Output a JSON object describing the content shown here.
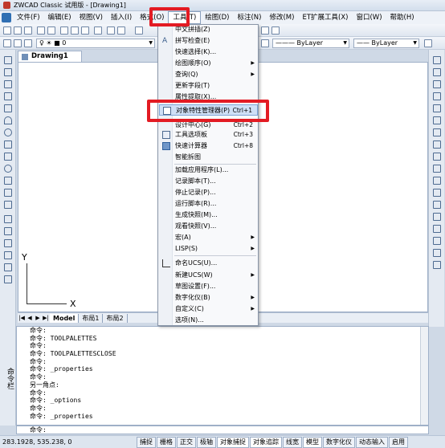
{
  "window": {
    "title": "ZWCAD Classic 试用版 - [Drawing1]"
  },
  "menubar": {
    "items": [
      "文件(F)",
      "编辑(E)",
      "视图(V)",
      "插入(I)",
      "格式(O)",
      "工具(T)",
      "绘图(D)",
      "标注(N)",
      "修改(M)",
      "ET扩展工具(X)",
      "窗口(W)",
      "帮助(H)"
    ]
  },
  "toolbar": {
    "layer_value": "0",
    "linetype_value": "ByLayer",
    "lineweight_value": "ByLayer"
  },
  "document": {
    "tab_title": "Drawing1"
  },
  "ucs": {
    "x_label": "X",
    "y_label": "Y"
  },
  "layout_tabs": [
    "Model",
    "布局1",
    "布局2"
  ],
  "tools_menu": {
    "items": [
      {
        "label": "中文拼插(Z)",
        "shortcut": "",
        "submenu": false
      },
      {
        "label": "拼写检查(E)",
        "shortcut": "",
        "submenu": false
      },
      {
        "label": "快速选择(K)...",
        "shortcut": "",
        "submenu": false
      },
      {
        "label": "绘图顺序(O)",
        "shortcut": "",
        "submenu": true
      },
      {
        "label": "查询(Q)",
        "shortcut": "",
        "submenu": true
      },
      {
        "label": "更新字段(T)",
        "shortcut": "",
        "submenu": false
      },
      {
        "label": "属性提取(X)...",
        "shortcut": "",
        "submenu": false
      },
      {
        "label": "对象特性管理器(P)",
        "shortcut": "Ctrl+1",
        "submenu": false
      },
      {
        "label": "设计中心(G)",
        "shortcut": "Ctrl+2",
        "submenu": false
      },
      {
        "label": "工具选项板",
        "shortcut": "Ctrl+3",
        "submenu": false
      },
      {
        "label": "快速计算器",
        "shortcut": "Ctrl+8",
        "submenu": false
      },
      {
        "label": "智能拆图",
        "shortcut": "",
        "submenu": false
      },
      {
        "label": "加载应用程序(L)...",
        "shortcut": "",
        "submenu": false
      },
      {
        "label": "记录脚本(T)...",
        "shortcut": "",
        "submenu": false
      },
      {
        "label": "停止记录(P)...",
        "shortcut": "",
        "submenu": false
      },
      {
        "label": "运行脚本(R)...",
        "shortcut": "",
        "submenu": false
      },
      {
        "label": "生成快照(M)...",
        "shortcut": "",
        "submenu": false
      },
      {
        "label": "观看快照(V)...",
        "shortcut": "",
        "submenu": false
      },
      {
        "label": "宏(A)",
        "shortcut": "",
        "submenu": true
      },
      {
        "label": "LISP(S)",
        "shortcut": "",
        "submenu": true
      },
      {
        "label": "命名UCS(U)...",
        "shortcut": "",
        "submenu": false
      },
      {
        "label": "新建UCS(W)",
        "shortcut": "",
        "submenu": true
      },
      {
        "label": "草图设置(F)...",
        "shortcut": "",
        "submenu": false
      },
      {
        "label": "数字化仪(B)",
        "shortcut": "",
        "submenu": true
      },
      {
        "label": "自定义(C)",
        "shortcut": "",
        "submenu": true
      },
      {
        "label": "选项(N)...",
        "shortcut": "",
        "submenu": false
      }
    ]
  },
  "command": {
    "side_label": "命令栏",
    "lines": [
      "命令:",
      "命令: TOOLPALETTES",
      "命令:",
      "命令: TOOLPALETTESCLOSE",
      "命令:",
      "命令: _properties",
      "命令:",
      "另一角点:",
      "命令:",
      "命令: _options",
      "命令:",
      "命令: _properties"
    ],
    "prompt": "命令:"
  },
  "status": {
    "coords": "283.1928, 535.238, 0",
    "buttons": [
      "捕捉",
      "栅格",
      "正交",
      "极轴",
      "对象捕捉",
      "对象追踪",
      "线宽",
      "模型",
      "数字化仪",
      "动态输入",
      "启用"
    ]
  },
  "colors": {
    "highlight": "#e31b23",
    "menu_hover": "#cfe0f6"
  }
}
